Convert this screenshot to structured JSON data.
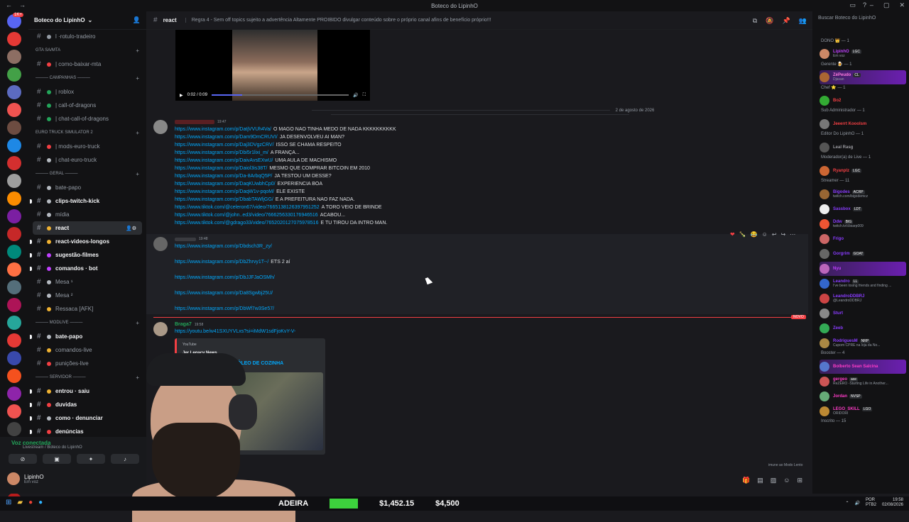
{
  "window": {
    "title": "Boteco do LipinhO"
  },
  "guild": {
    "name": "Boteco do LipinhO"
  },
  "servers": {
    "badge": "1K+",
    "colors": [
      "#e53935",
      "#8d6e63",
      "#43a047",
      "#5c6bc0",
      "#ef5350",
      "#6d4c41",
      "#1e88e5",
      "#d32f2f",
      "#9e9e9e",
      "#fb8c00",
      "#7b1fa2",
      "#c62828",
      "#00897b",
      "#ff7043",
      "#546e7a",
      "#ad1457",
      "#26a69a",
      "#e53935",
      "#3949ab",
      "#f4511e",
      "#8e24aa",
      "#ef5350",
      "#424242",
      "#1565c0",
      "#d81b60",
      "#43a047",
      "#b71c1c"
    ]
  },
  "channels": [
    {
      "kind": "ch",
      "label": "l ·rotulo-tradeiro",
      "icon": "",
      "bright": false
    },
    {
      "kind": "cat",
      "label": "GTA SA/MTA"
    },
    {
      "kind": "ch",
      "label": "| como-baixar-mta",
      "icon": "red",
      "bright": false
    },
    {
      "kind": "cat",
      "label": "——— CAMPANHAS ———"
    },
    {
      "kind": "ch",
      "label": "| roblox",
      "icon": "green",
      "bright": false
    },
    {
      "kind": "ch",
      "label": "| call-of-dragons",
      "icon": "green",
      "bright": false
    },
    {
      "kind": "ch",
      "label": "| chat-call-of-dragons",
      "icon": "green",
      "bright": false
    },
    {
      "kind": "cat",
      "label": "Euro Truck Simulator 2"
    },
    {
      "kind": "ch",
      "label": "| mods-euro-truck",
      "icon": "red",
      "bright": false
    },
    {
      "kind": "ch",
      "label": "| chat-euro-truck",
      "icon": "gray",
      "bright": false
    },
    {
      "kind": "cat",
      "label": "——— GERAL ———"
    },
    {
      "kind": "ch",
      "label": "bate-papo",
      "icon": "gray",
      "bright": false
    },
    {
      "kind": "ch",
      "label": "clips-twitch-kick",
      "icon": "gray",
      "bright": true
    },
    {
      "kind": "ch",
      "label": "mídia",
      "icon": "gray",
      "bright": false
    },
    {
      "kind": "ch",
      "label": "react",
      "icon": "orange",
      "bright": true,
      "active": true
    },
    {
      "kind": "ch",
      "label": "react-videos-longos",
      "icon": "orange",
      "bright": true
    },
    {
      "kind": "ch",
      "label": "sugestão-filmes",
      "icon": "purple",
      "bright": true
    },
    {
      "kind": "ch",
      "label": "comandos · bot",
      "icon": "purple",
      "bright": true
    },
    {
      "kind": "ch",
      "label": "Mesa ¹",
      "icon": "gray",
      "bright": false
    },
    {
      "kind": "ch",
      "label": "Mesa ²",
      "icon": "gray",
      "bright": false
    },
    {
      "kind": "ch",
      "label": "Ressaca [AFK]",
      "icon": "orange",
      "bright": false
    },
    {
      "kind": "cat",
      "label": "——— MODLIVE ———"
    },
    {
      "kind": "ch",
      "label": "bate-papo",
      "icon": "gray",
      "bright": true
    },
    {
      "kind": "ch",
      "label": "comandos-live",
      "icon": "orange",
      "bright": false
    },
    {
      "kind": "ch",
      "label": "punições-live",
      "icon": "red",
      "bright": false
    },
    {
      "kind": "cat",
      "label": "——— SERVIDOR ———"
    },
    {
      "kind": "ch",
      "label": "entrou · saiu",
      "icon": "orange",
      "bright": true
    },
    {
      "kind": "ch",
      "label": "duvidas",
      "icon": "red",
      "bright": true
    },
    {
      "kind": "ch",
      "label": "como · denunciar",
      "icon": "gray",
      "bright": true
    },
    {
      "kind": "ch",
      "label": "denúncias",
      "icon": "red",
      "bright": true
    }
  ],
  "voice": {
    "status": "Voz conectada",
    "sub": "Livestream / Boteco do LipinhO",
    "new_badge": "NOVO"
  },
  "user": {
    "name": "LipinhO",
    "status": "Em voz"
  },
  "header": {
    "channel": "react",
    "topic": "Regra 4 - Sem off topics sujeito a advertência Altamente PROIBIDO divulgar conteúdo sobre o próprio canal afins de benefício próprio!!!",
    "search_placeholder": "Buscar Boteco do LipinhO"
  },
  "video": {
    "time": "0:02 / 0:09",
    "progress": 0.22
  },
  "date_divider": "2 de agosto de 2026",
  "message1": {
    "author": "",
    "time": "19:47",
    "lines": [
      {
        "link": "https://www.instagram.com/p/DatjVVUh4Va/",
        "text": "O MAGO NAO TINHA MEDO DE NADA KKKKKKKKKK"
      },
      {
        "link": "https://www.instagram.com/p/Dam9DmCRUVI/",
        "text": "JA DESENVOLVEU AI MAN?"
      },
      {
        "link": "https://www.instagram.com/p/Daj3DVgzCRV/",
        "text": "ISSO SE CHAMA RESPEITO"
      },
      {
        "link": "https://www.instagram.com/p/Dbi5r1lixi_m/",
        "text": "A FRANÇA..."
      },
      {
        "link": "https://www.instagram.com/p/DaivAvsEXwU/",
        "text": "UMA AULA DE MACHISMO"
      },
      {
        "link": "https://www.instagram.com/p/Daiol3is38T/",
        "text": "MESMO QUE COMPRAR BITCOIN EM 2010"
      },
      {
        "link": "https://www.instagram.com/p/Da-8ArbqQ5P/",
        "text": "JA TESTOU UM DESSE?"
      },
      {
        "link": "https://www.instagram.com/p/DaqKUwbhCp0/",
        "text": "EXPERIENCIA BOA"
      },
      {
        "link": "https://www.instagram.com/p/DaqW1v-pqoM/",
        "text": "ELE EXISTE"
      },
      {
        "link": "https://www.instagram.com/p/DbabTAWljGG/",
        "text": "E A PREFEITURA NAO FAZ NADA."
      },
      {
        "link": "https://www.tiktok.com/@celeron67/video/7665138126397951252",
        "text": "A TORO VEIO DE BRINDE"
      },
      {
        "link": "https://www.tiktok.com/@john..ed3/video/7666256330176946516",
        "text": "ACABOU..."
      },
      {
        "link": "https://www.tiktok.com/@gdrago33/video/7652020127075978516",
        "text": "E TU TIROU DA INTRO MAN."
      }
    ]
  },
  "message2": {
    "author": "",
    "time": "19:48",
    "lines": [
      {
        "link": "https://www.instagram.com/p/Dbdsch3R_zy/",
        "text": ""
      },
      {
        "link": "",
        "text": ""
      },
      {
        "link": "https://www.instagram.com/p/DbZhrvy1T--/",
        "text": "ETS 2 aí"
      },
      {
        "link": "",
        "text": ""
      },
      {
        "link": "https://www.instagram.com/p/DbJJFJaOSMh/",
        "text": ""
      },
      {
        "link": "",
        "text": ""
      },
      {
        "link": "https://www.instagram.com/p/Da8Sgwbj25U/",
        "text": ""
      },
      {
        "link": "",
        "text": ""
      },
      {
        "link": "https://www.instagram.com/p/DbWf7w3Se57/",
        "text": ""
      }
    ]
  },
  "new_tag": "NOVO",
  "message3": {
    "author": "Braga7",
    "time": "19:58",
    "link": "https://youtu.be/w41SXUYVLxs?si=iMdW1sdFjoKvY-V-",
    "embed_provider": "YouTube",
    "embed_author": "Jer Legacy News",
    "embed_title": "ABASTER MOTO COM ÓLEO DE COZINHA"
  },
  "composer_hint": "imune ao Modo Lento",
  "members": [
    {
      "group": "DONO 👑 — 1"
    },
    {
      "name": "LipinhO",
      "color": "#c040ff",
      "tag": "LGC",
      "sub": "Em voz",
      "av": "#c86"
    },
    {
      "group": "Gerente 🍺 — 1"
    },
    {
      "name": "ZéPeudo",
      "color": "#ff7adf",
      "tag": "CL",
      "sub": "Djavan",
      "av": "#a63",
      "hl": true
    },
    {
      "group": "Chef ⭐ — 1"
    },
    {
      "name": "Bo2",
      "color": "#f23f43",
      "tag": "",
      "sub": "",
      "av": "#3a3"
    },
    {
      "group": "Sub Administrador — 1"
    },
    {
      "name": "Jeeerrt Kooolsm",
      "color": "#f23f43",
      "tag": "",
      "sub": "",
      "av": "#777"
    },
    {
      "group": "Editor Do LipinhO — 1"
    },
    {
      "name": "Leal Rasg",
      "color": "#9a9aa0",
      "tag": "",
      "sub": "",
      "av": "#555"
    },
    {
      "group": "Moderador(a) de Live — 1"
    },
    {
      "name": "Ryanplz",
      "color": "#f23f43",
      "tag": "LGC",
      "sub": "",
      "av": "#c63"
    },
    {
      "group": "Streamer — 11"
    },
    {
      "name": "Bigodes",
      "color": "#8a3cff",
      "tag": "ACRP",
      "sub": "twitch.com/bigodemcz",
      "av": "#963"
    },
    {
      "name": "Sassbox",
      "color": "#8a3cff",
      "tag": "LDT",
      "sub": "",
      "av": "#eee"
    },
    {
      "name": "Ddw",
      "color": "#8a3cff",
      "tag": "BIG",
      "sub": "twitch.tv/cbsarp009",
      "av": "#e53"
    },
    {
      "name": "Frigo",
      "color": "#8a3cff",
      "tag": "",
      "sub": "",
      "av": "#c66"
    },
    {
      "name": "Gorgrim",
      "color": "#8a3cff",
      "tag": "GOAT",
      "sub": "",
      "av": "#666"
    },
    {
      "name": "Nyu",
      "color": "#c040ff",
      "tag": "",
      "sub": "",
      "av": "#b6b",
      "hl": true
    },
    {
      "name": "Leandro",
      "color": "#8a3cff",
      "tag": "LL",
      "sub": "I've been losing friends and finding ...",
      "av": "#36c"
    },
    {
      "name": "LeandroDDBRJ",
      "color": "#8a3cff",
      "tag": "",
      "sub": "@LeandroDDBRJ",
      "av": "#c44"
    },
    {
      "name": "Sturt",
      "color": "#8a3cff",
      "tag": "",
      "sub": "",
      "av": "#888"
    },
    {
      "name": "Zeeb",
      "color": "#8a3cff",
      "tag": "",
      "sub": "",
      "av": "#3a5"
    },
    {
      "name": "RodriguesM",
      "color": "#8a3cff",
      "tag": "NRP",
      "sub": "Cupom CPRE na loja da No...",
      "av": "#a84"
    },
    {
      "group": "Booster — 4"
    },
    {
      "name": "Bolberto Sean Salcina",
      "color": "#ff3cc8",
      "tag": "",
      "sub": "",
      "av": "#57c",
      "hl": true
    },
    {
      "name": "gergeo",
      "color": "#ff3cc8",
      "tag": "axe",
      "sub": "ReZERO -Starting Life in Another...",
      "av": "#c55"
    },
    {
      "name": "Jordan",
      "color": "#ff3cc8",
      "tag": "NVSP",
      "sub": "",
      "av": "#6a7"
    },
    {
      "name": "LEGO_SKILL",
      "color": "#ff3cc8",
      "tag": "LGO",
      "sub": "ORIDORI",
      "av": "#b83"
    },
    {
      "group": "Inscrito — 15"
    }
  ],
  "taskbar": {
    "ticker_text": "ADEIRA",
    "price1": "$1,452.15",
    "price2": "$4,500",
    "lang": "POR\nPTB2",
    "time": "19:58",
    "date": "02/08/2026"
  }
}
